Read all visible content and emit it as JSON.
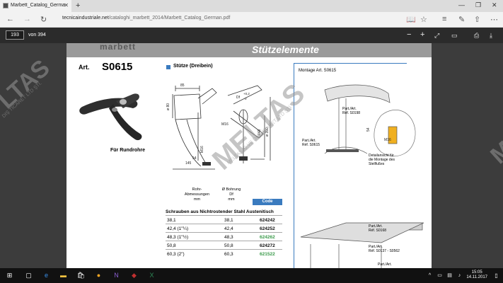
{
  "browser": {
    "tab_title": "Marbett_Catalog_Germa",
    "url_domain": "tecnicaindustriale.net",
    "url_path": "/cataloghi_marbett_2014/Marbett_Catalog_German.pdf"
  },
  "pdf_toolbar": {
    "page_number": "193",
    "page_total": "von 394"
  },
  "pdf_page": {
    "header_logo": "marbett",
    "header_title": "Stützelemente",
    "art_prefix": "Art.",
    "art_number": "S0615",
    "section_title": "Stütze (Dreibein)",
    "product_caption": "Für Rundrohre",
    "montage_label": "Montage Art. S0615",
    "drawing_dims": {
      "d85": "85",
      "d80": "ø 80",
      "d02": "+0,2",
      "d0": "0",
      "df": "Df",
      "m16a": "M16",
      "d448": "448",
      "d390": "ø 390",
      "m16b": "M16",
      "d54": "54",
      "d145": "145"
    },
    "table": {
      "col1_header": [
        "Rohr-",
        "Abmessungen",
        "mm"
      ],
      "col2_header": [
        "Ø Bohrung",
        "Df",
        "mm"
      ],
      "code_header": "Code",
      "subheader": "Schrauben aus Nichtrostender Stahl Austenitisch",
      "rows": [
        {
          "dim": "38,1",
          "bore": "38,1",
          "code": "624242",
          "color": "#111111"
        },
        {
          "dim": "42,4 (1\"¼)",
          "bore": "42,4",
          "code": "624252",
          "color": "#111111"
        },
        {
          "dim": "48,3 (1\"½)",
          "bore": "48,3",
          "code": "624262",
          "color": "#3a9a4a"
        },
        {
          "dim": "50,8",
          "bore": "50,8",
          "code": "624272",
          "color": "#111111"
        },
        {
          "dim": "60,3 (2\")",
          "bore": "60,3",
          "code": "621522",
          "color": "#3a9a4a"
        }
      ]
    },
    "right_labels": {
      "part1": [
        "Part./Art.",
        "Réf. S0198"
      ],
      "part2": [
        "Part./Art.",
        "Réf. S0615"
      ],
      "dim54": "54",
      "m16": "M16",
      "detail": [
        "Detailansicht für",
        "die Montage des",
        "Stellfußes"
      ],
      "part3": [
        "Part./Art.",
        "Réf. S0168"
      ],
      "part4": [
        "Part./Art.",
        "Réf. S0137 - S0562"
      ],
      "part5": "Part./Art."
    }
  },
  "watermark": {
    "main": "MELTAS",
    "sub": "MELTAS İÇ VE DIŞ TİCARET LTD ŞTİ.",
    "left_main": "LTAS",
    "left_sub": "DIŞ TİCARET LTD ŞTİ.",
    "right_main": "M"
  },
  "taskbar": {
    "time": "15:05",
    "date": "14.11.2017"
  }
}
